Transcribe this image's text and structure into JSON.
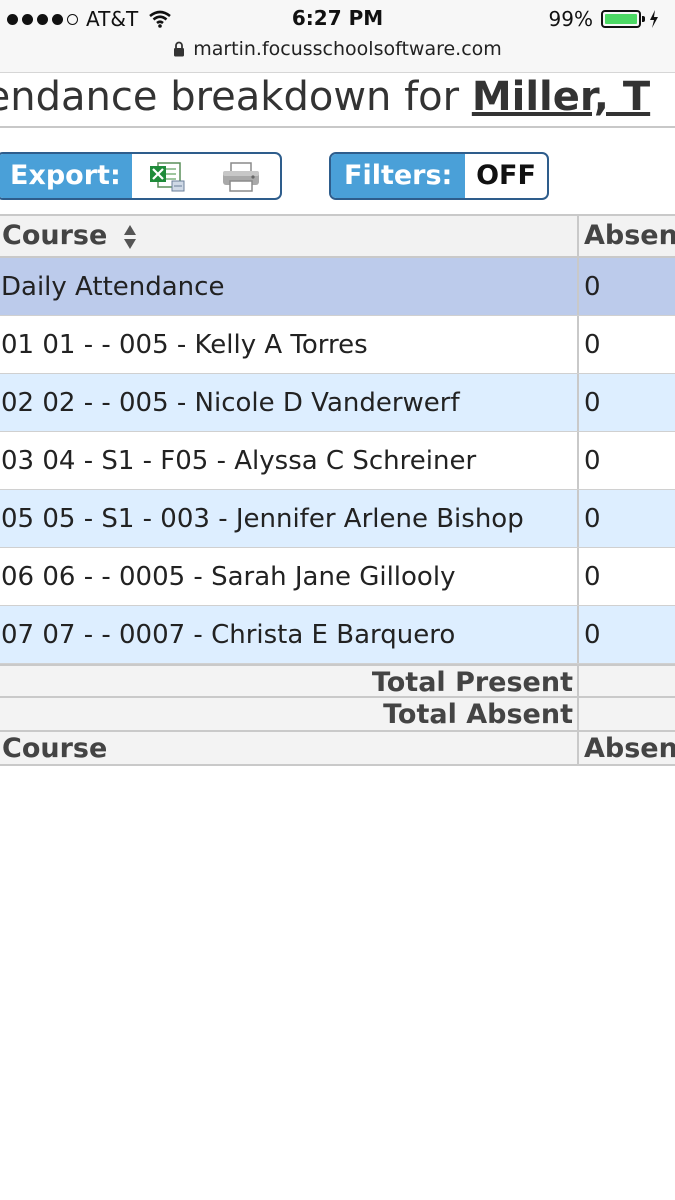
{
  "status_bar": {
    "carrier": "AT&T",
    "time": "6:27 PM",
    "battery_percent": "99%",
    "battery_level": 0.99,
    "url": "martin.focusschoolsoftware.com",
    "battery_color": "#4cd964"
  },
  "page": {
    "title_prefix": "tendance breakdown for ",
    "student_name": "Miller, T"
  },
  "toolbar": {
    "export_label": "Export:",
    "filters_label": "Filters:",
    "filters_value": "OFF",
    "accent_color": "#4aa0d8",
    "icons": [
      "excel-icon",
      "print-icon"
    ]
  },
  "table": {
    "columns": [
      "Course",
      "Absen"
    ],
    "sort_icon": "sort-arrows-icon",
    "rows": [
      {
        "course": "Daily Attendance",
        "absent": "0"
      },
      {
        "course": "01 01 - - 005 - Kelly A Torres",
        "absent": "0"
      },
      {
        "course": "02 02 - - 005 - Nicole D Vanderwerf",
        "absent": "0"
      },
      {
        "course": "03 04 - S1 - F05 - Alyssa C Schreiner",
        "absent": "0"
      },
      {
        "course": "05 05 - S1 - 003 - Jennifer Arlene Bishop",
        "absent": "0"
      },
      {
        "course": "06 06 - - 0005 - Sarah Jane Gillooly",
        "absent": "0"
      },
      {
        "course": "07 07 - - 0007 - Christa E Barquero",
        "absent": "0"
      }
    ],
    "total_present_label": "Total Present",
    "total_absent_label": "Total Absent",
    "footer_columns": [
      "Course",
      "Absen"
    ],
    "row_colors": [
      "#bccbeb",
      "#ffffff",
      "#ddeeff"
    ]
  }
}
